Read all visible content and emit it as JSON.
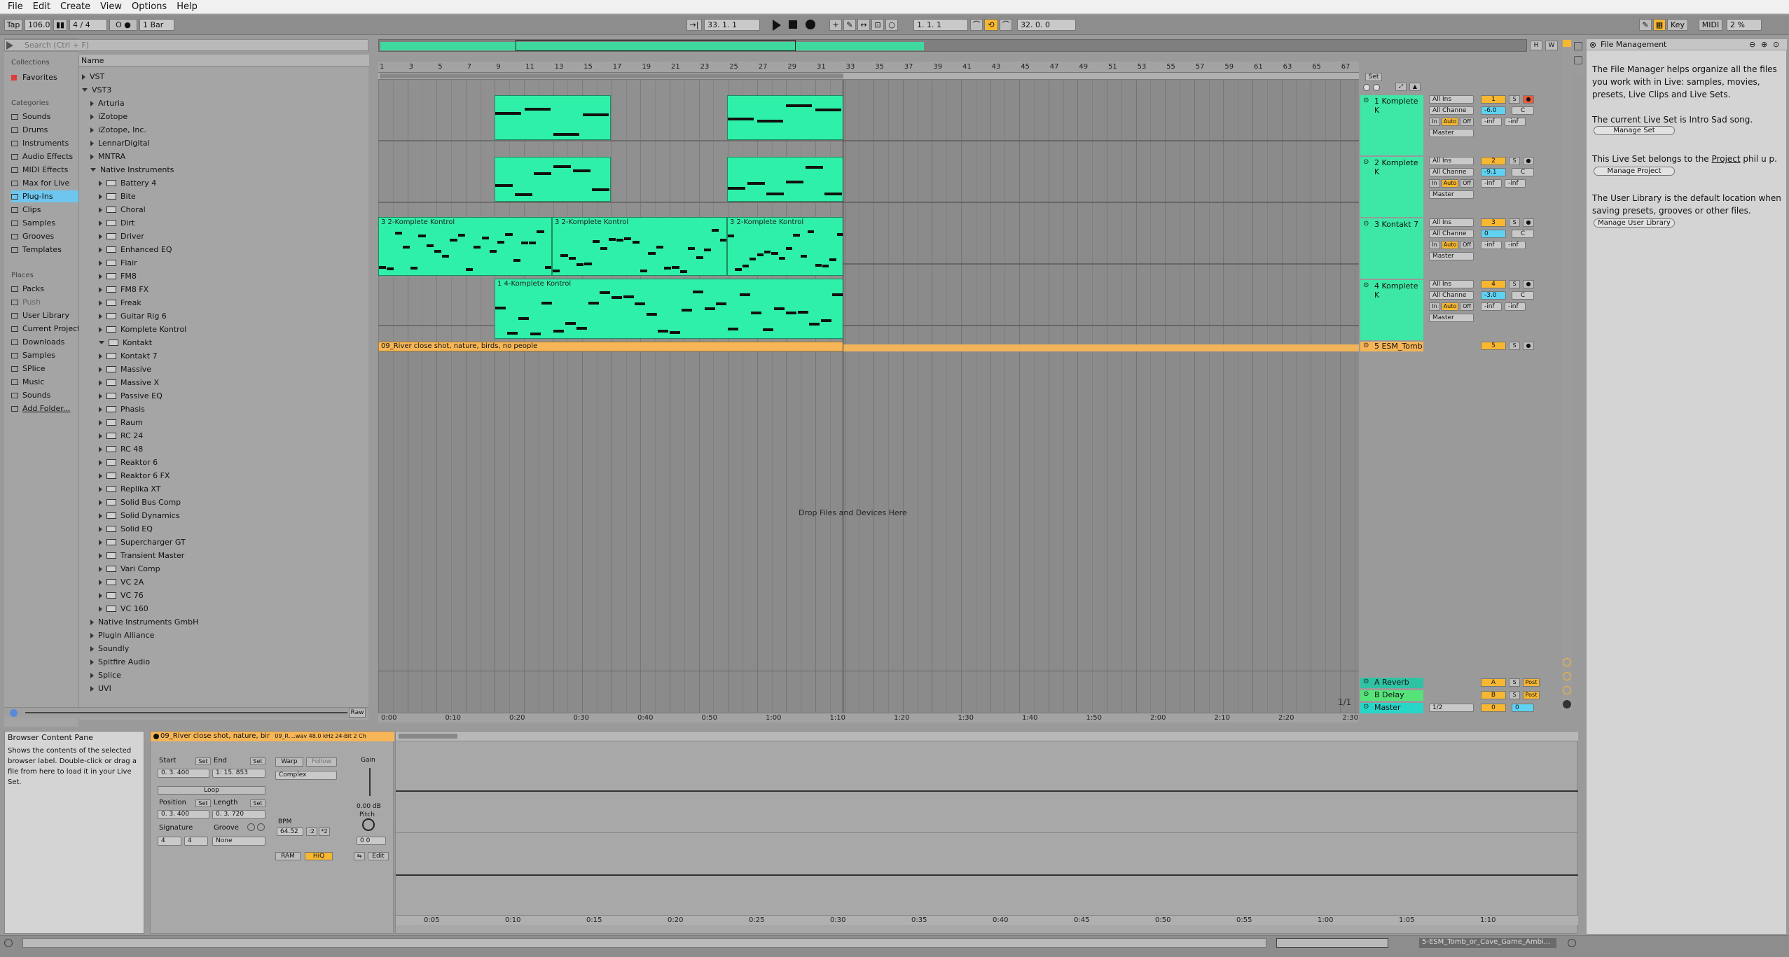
{
  "menu": [
    "File",
    "Edit",
    "Create",
    "View",
    "Options",
    "Help"
  ],
  "control_bar": {
    "tap": "Tap",
    "tempo": "106.00",
    "signature": "4 / 4",
    "metronome": "O ●",
    "quantize": "1 Bar",
    "position": "33.   1.   1",
    "loop_start": "1.   1.   1",
    "loop_length": "32.   0.   0",
    "key": "Key",
    "midi": "MIDI",
    "cpu": "2 %"
  },
  "browser": {
    "search_placeholder": "Search (Ctrl + F)",
    "collections_label": "Collections",
    "favorites": "Favorites",
    "categories_label": "Categories",
    "categories": [
      "Sounds",
      "Drums",
      "Instruments",
      "Audio Effects",
      "MIDI Effects",
      "Max for Live",
      "Plug-Ins",
      "Clips",
      "Samples",
      "Grooves",
      "Templates"
    ],
    "places_label": "Places",
    "places": [
      "Packs",
      "Push",
      "User Library",
      "Current Project",
      "Downloads",
      "Samples",
      "SPlice",
      "Music",
      "Sounds",
      "Add Folder..."
    ],
    "name_header": "Name",
    "tree_top": [
      "VST",
      "VST3"
    ],
    "vendors_before": [
      "Arturia",
      "iZotope",
      "iZotope, Inc.",
      "LennarDigital",
      "MNTRA",
      "Native Instruments"
    ],
    "ni_plugins": [
      "Battery 4",
      "Bite",
      "Choral",
      "Dirt",
      "Driver",
      "Enhanced EQ",
      "Flair",
      "FM8",
      "FM8 FX",
      "Freak",
      "Guitar Rig 6",
      "Komplete Kontrol",
      "Kontakt",
      "Kontakt 7",
      "Massive",
      "Massive X",
      "Passive EQ",
      "Phasis",
      "Raum",
      "RC 24",
      "RC 48",
      "Reaktor 6",
      "Reaktor 6 FX",
      "Replika XT",
      "Solid Bus Comp",
      "Solid Dynamics",
      "Solid EQ",
      "Supercharger GT",
      "Transient Master",
      "Vari Comp",
      "VC 2A",
      "VC 76",
      "VC 160"
    ],
    "vendors_after": [
      "Native Instruments GmbH",
      "Plugin Alliance",
      "Soundly",
      "Spitfire Audio",
      "Splice",
      "UVI"
    ],
    "raw": "Raw"
  },
  "arrangement": {
    "bar_numbers": [
      "1",
      "3",
      "5",
      "7",
      "9",
      "11",
      "13",
      "15",
      "17",
      "19",
      "21",
      "23",
      "25",
      "27",
      "29",
      "31",
      "33",
      "35",
      "37",
      "39",
      "41",
      "43",
      "45",
      "47",
      "49",
      "51",
      "53",
      "55",
      "57",
      "59",
      "61",
      "63",
      "65",
      "67"
    ],
    "time_labels": [
      "0:00",
      "0:10",
      "0:20",
      "0:30",
      "0:40",
      "0:50",
      "1:00",
      "1:10",
      "1:20",
      "1:30",
      "1:40",
      "1:50",
      "2:00",
      "2:10",
      "2:20",
      "2:30"
    ],
    "drop_text": "Drop Files and Devices Here",
    "page_indicator": "1/1",
    "set_label": "Set",
    "clips": {
      "kk": "3 2-Komplete Kontrol",
      "kk4": "1 4-Komplete Kontrol",
      "audio": "09_River close shot, nature, birds, no people"
    }
  },
  "tracks": [
    {
      "name": "1 Komplete K",
      "input": "All Ins",
      "channel": "All Channe",
      "num": "1",
      "vol": "-6.0",
      "pan": "C",
      "inf1": "-inf",
      "inf2": "-inf",
      "out": "Master"
    },
    {
      "name": "2 Komplete K",
      "input": "All Ins",
      "channel": "All Channe",
      "num": "2",
      "vol": "-9.1",
      "pan": "C",
      "inf1": "-inf",
      "inf2": "-inf",
      "out": "Master"
    },
    {
      "name": "3 Kontakt 7",
      "input": "All Ins",
      "channel": "All Channe",
      "num": "3",
      "vol": "0",
      "pan": "C",
      "inf1": "-inf",
      "inf2": "-inf",
      "out": "Master"
    },
    {
      "name": "4 Komplete K",
      "input": "All Ins",
      "channel": "All Channe",
      "num": "4",
      "vol": "-3.0",
      "pan": "C",
      "inf1": "-inf",
      "inf2": "-inf",
      "out": "Master"
    },
    {
      "name": "5 ESM_Tomb",
      "num": "5"
    }
  ],
  "returns": [
    {
      "name": "A Reverb",
      "num": "A",
      "post": "Post"
    },
    {
      "name": "B Delay",
      "num": "B",
      "post": "Post"
    },
    {
      "name": "Master",
      "num": "0",
      "out": "1/2"
    }
  ],
  "mixer_labels": {
    "in": "In",
    "auto": "Auto",
    "off": "Off",
    "s": "S"
  },
  "info_panel": {
    "title": "File Management",
    "p1": "The File Manager helps organize all the files you work with in Live: samples, movies, presets, Live Clips and Live Sets.",
    "btn1": "Manage Set",
    "p2": "The current Live Set is Intro Sad song.",
    "p3_a": "This Live Set belongs to the",
    "p3_link": "Project",
    "p3_b": "phil u p.",
    "btn2": "Manage Project",
    "p4": "The User Library is the default location when saving presets, grooves or other files.",
    "btn3": "Manage User Library"
  },
  "help_box": {
    "title": "Browser Content Pane",
    "text": "Shows the contents of the selected browser label. Double-click or drag a file from here to load it in your Live Set."
  },
  "clip_view": {
    "clip_name": "09_River close shot, nature, bir",
    "file_info": "09_R....wav  48.0 kHz  24-Bit  2 Ch",
    "start_label": "Start",
    "end_label": "End",
    "set": "Set",
    "start_val": "0.   3.  400",
    "end_val": "1:   15.   853",
    "loop": "Loop",
    "position_label": "Position",
    "length_label": "Length",
    "position_val": "0.   3.  400",
    "length_val": "0.   3.  720",
    "signature_label": "Signature",
    "groove_label": "Groove",
    "sig_num": "4",
    "sig_den": "4",
    "groove_val": "None",
    "warp": "Warp",
    "follow": "Follow",
    "warp_mode": "Complex",
    "bpm_label": "BPM",
    "bpm_val": "64.52",
    "gain_label": "Gain",
    "gain_val": "0.00 dB",
    "pitch_label": "Pitch",
    "pitch_val": "0    0",
    "ram": "RAM",
    "hiq": "HiQ",
    "edit": "Edit",
    "time_labels": [
      "0:05",
      "0:10",
      "0:15",
      "0:20",
      "0:25",
      "0:30",
      "0:35",
      "0:40",
      "0:45",
      "0:50",
      "0:55",
      "1:00",
      "1:05",
      "1:10"
    ]
  },
  "status": {
    "clip": "5-ESM_Tomb_or_Cave_Game_Ambi..."
  }
}
